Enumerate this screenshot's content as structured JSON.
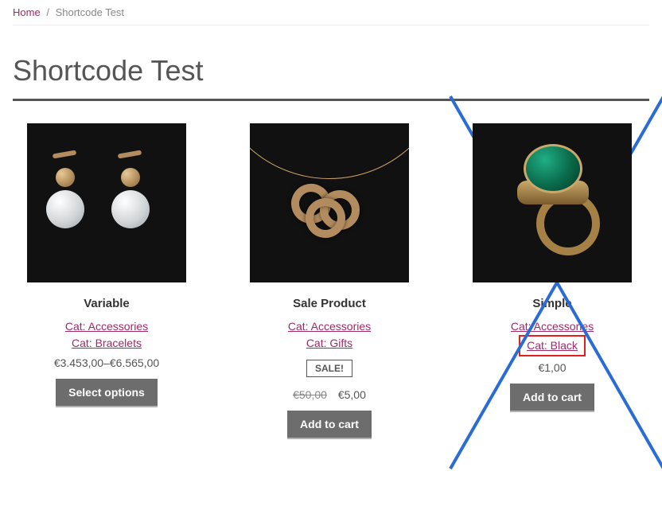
{
  "breadcrumb": {
    "home": "Home",
    "current": "Shortcode Test"
  },
  "page": {
    "title": "Shortcode Test"
  },
  "products": [
    {
      "title": "Variable",
      "cats": [
        "Cat: Accessories",
        "Cat: Bracelets"
      ],
      "price_text": "€3.453,00–€6.565,00",
      "button": "Select options"
    },
    {
      "title": "Sale Product",
      "cats": [
        "Cat: Accessories",
        "Cat: Gifts"
      ],
      "sale_badge": "SALE!",
      "old_price": "€50,00",
      "price_text": "€5,00",
      "button": "Add to cart"
    },
    {
      "title": "Simple",
      "cats": [
        "Cat: Accessories",
        "Cat: Black"
      ],
      "highlight_cat_index": 1,
      "price_text": "€1,00",
      "button": "Add to cart",
      "crossed_out": true
    }
  ]
}
